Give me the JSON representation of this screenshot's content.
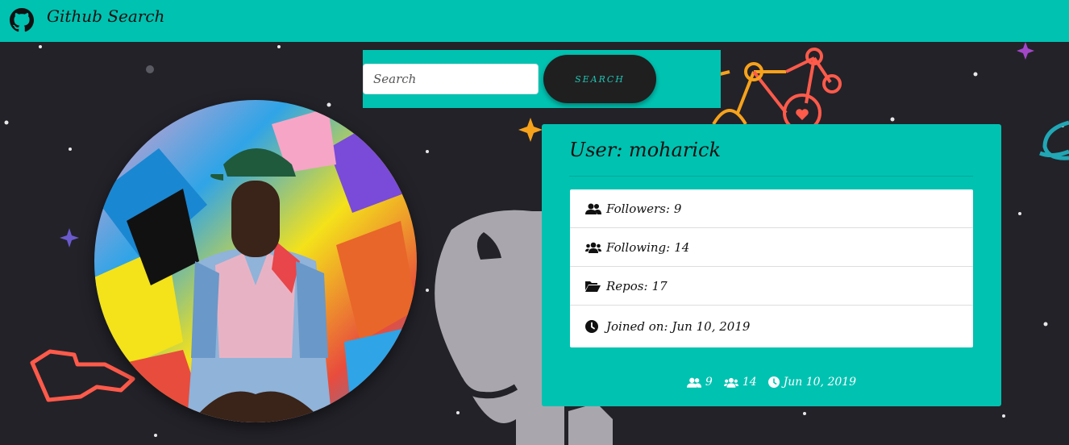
{
  "header": {
    "brand": "Github Search",
    "logo_icon": "github-logo-icon"
  },
  "search": {
    "placeholder": "Search",
    "value": "",
    "button_label": "SEARCH"
  },
  "profile": {
    "title": "User: moharick",
    "details": [
      {
        "icon": "users-icon",
        "label": "Followers:",
        "value": "9"
      },
      {
        "icon": "user-group-icon",
        "label": "Following:",
        "value": "14"
      },
      {
        "icon": "folder-open-icon",
        "label": "Repos:",
        "value": "17"
      },
      {
        "icon": "clock-icon",
        "label": "Joined on:",
        "value": "Jun 10, 2019"
      }
    ],
    "stats": {
      "followers": "9",
      "following": "14",
      "joined": "Jun 10, 2019"
    }
  },
  "colors": {
    "accent": "#00c2b1",
    "background": "#232229",
    "button": "#1f1f1f"
  }
}
